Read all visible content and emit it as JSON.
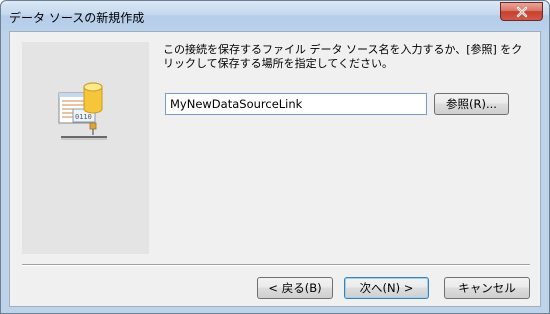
{
  "window": {
    "title": "データ ソースの新規作成"
  },
  "main": {
    "instruction": "この接続を保存するファイル データ ソース名を入力するか、[参照] をクリックして保存する場所を指定してください。",
    "name_input_value": "MyNewDataSourceLink",
    "browse_label": "参照(R)..."
  },
  "footer": {
    "back_label": "< 戻る(B)",
    "next_label": "次へ(N) >",
    "cancel_label": "キャンセル"
  },
  "icons": {
    "close": "close-icon",
    "database": "database-icon"
  },
  "colors": {
    "title_gradient_top": "#dbe8f6",
    "close_button": "#c7412c",
    "panel_gray": "#e4e4e4",
    "client_bg": "#f0f0f0",
    "default_button_border": "#3c7fb1"
  }
}
